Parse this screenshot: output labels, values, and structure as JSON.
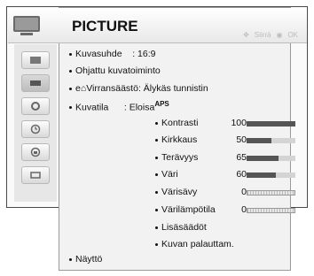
{
  "header": {
    "title": "PICTURE",
    "hint_move": "Siirrä",
    "hint_ok": "OK"
  },
  "colors": {
    "bar_fill": "#555555",
    "bar_track": "#d4d4d4"
  },
  "menu": [
    {
      "bullet": true,
      "label": "Kuvasuhde",
      "value": ": 16:9"
    },
    {
      "bullet": true,
      "label": "Ohjattu kuvatoiminto"
    },
    {
      "bullet": true,
      "label": "Virransäästö: Älykäs tunnistin"
    },
    {
      "bullet": true,
      "label": "Kuvatila",
      "value": ": Eloisa",
      "badge": "APS"
    }
  ],
  "sub": [
    {
      "label": "Kontrasti",
      "value": "100",
      "level": 1.0
    },
    {
      "label": "Kirkkaus",
      "value": "50",
      "level": 0.5
    },
    {
      "label": "Terävyys",
      "value": "65",
      "level": 0.65
    },
    {
      "label": "Väri",
      "value": "60",
      "level": 0.6
    },
    {
      "label": "Värisävy",
      "value": "0"
    },
    {
      "label": "Värilämpötila",
      "value": "0"
    },
    {
      "label": "Lisäsäädöt"
    },
    {
      "label": "Kuvan palauttam."
    }
  ],
  "footer": {
    "label": "Näyttö"
  },
  "sidebar": {
    "icons": [
      "picture-icon",
      "tv-icon",
      "settings-icon",
      "clock-icon",
      "lock-icon",
      "input-icon"
    ]
  }
}
